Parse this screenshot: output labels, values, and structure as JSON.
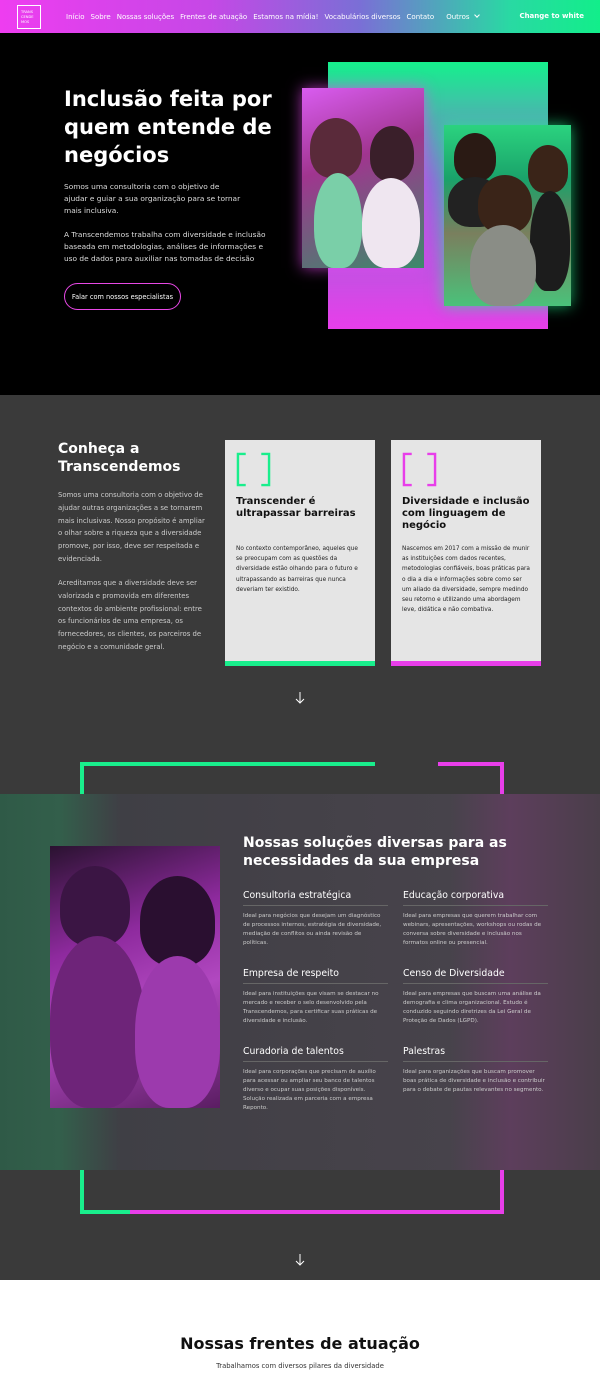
{
  "nav": {
    "logo_lines": [
      "TRANS",
      "CENDE",
      "MOS"
    ],
    "links": [
      "Início",
      "Sobre",
      "Nossas soluções",
      "Frentes de atuação",
      "Estamos na mídia!",
      "Vocabulários diversos",
      "Contato"
    ],
    "outros": "Outros",
    "change": "Change to white"
  },
  "hero": {
    "title": "Inclusão feita por quem entende de negócios",
    "p1": "Somos uma consultoria com o objetivo de ajudar e guiar a sua organização para se tornar mais inclusiva.",
    "p2": "A Transcendemos trabalha com diversidade e inclusão baseada em metodologias, análises de informações e uso de dados para auxiliar nas tomadas de decisão",
    "button": "Falar com nossos especialistas"
  },
  "about": {
    "title": "Conheça a Transcendemos",
    "p1": "Somos uma consultoria com o objetivo de ajudar outras organizações a se tornarem mais inclusivas. Nosso propósito é ampliar o olhar sobre a riqueza que a diversidade promove, por isso, deve ser respeitada e evidenciada.",
    "p2": "Acreditamos que a diversidade deve ser valorizada e promovida em diferentes contextos do ambiente profissional: entre os funcionários de uma empresa, os fornecedores, os clientes, os parceiros de negócio e a comunidade geral.",
    "cards": [
      {
        "title": "Transcender é ultrapassar barreiras",
        "text": "No contexto contemporâneo, aqueles que se preocupam com as questões da diversidade estão olhando para o futuro e ultrapassando as barreiras que nunca deveriam ter existido.",
        "accent": "#19ee8c"
      },
      {
        "title": "Diversidade e inclusão com linguagem de negócio",
        "text": "Nascemos em 2017 com a missão de munir as instituições com dados recentes, metodologias confiáveis, boas práticas para o dia a dia e informações sobre como ser um aliado da diversidade, sempre medindo seu retorno e utilizando uma abordagem leve, didática e não combativa.",
        "accent": "#e83eea"
      }
    ]
  },
  "solutions": {
    "title": "Nossas soluções diversas para as necessidades da sua empresa",
    "items": [
      {
        "title": "Consultoria estratégica",
        "text": "Ideal para negócios que desejam um diagnóstico de processos internos, estratégia de diversidade, mediação de conflitos ou ainda revisão de políticas."
      },
      {
        "title": "Educação corporativa",
        "text": "Ideal para empresas que querem trabalhar com webinars, apresentações, workshops ou rodas de conversa sobre diversidade e inclusão nos formatos online ou presencial."
      },
      {
        "title": "Empresa de respeito",
        "text": "Ideal para instituições que visam se destacar no mercado e receber o selo desenvolvido pela Transcendemos, para certificar suas práticas de diversidade e inclusão."
      },
      {
        "title": "Censo de Diversidade",
        "text": "Ideal para empresas que buscam uma análise da demografia e clima organizacional. Estudo é conduzido seguindo diretrizes da Lei Geral de Proteção de Dados (LGPD)."
      },
      {
        "title": "Curadoria de talentos",
        "text": "Ideal para corporações que precisam de auxílio para acessar ou ampliar seu banco de talentos diverso e ocupar suas posições disponíveis. Solução realizada em parceria com a empresa Reponto."
      },
      {
        "title": "Palestras",
        "text": "Ideal para organizações que buscam promover boas prática de diversidade e inclusão e contribuir para o debate de pautas relevantes no segmento."
      }
    ]
  },
  "fronts": {
    "title": "Nossas frentes de atuação",
    "subtitle": "Trabalhamos com diversos pilares da diversidade"
  },
  "colors": {
    "green": "#19ee8c",
    "magenta": "#e83eea"
  },
  "icons": [
    "bracket-icon",
    "arrow-down-icon",
    "chevron-down-icon"
  ]
}
